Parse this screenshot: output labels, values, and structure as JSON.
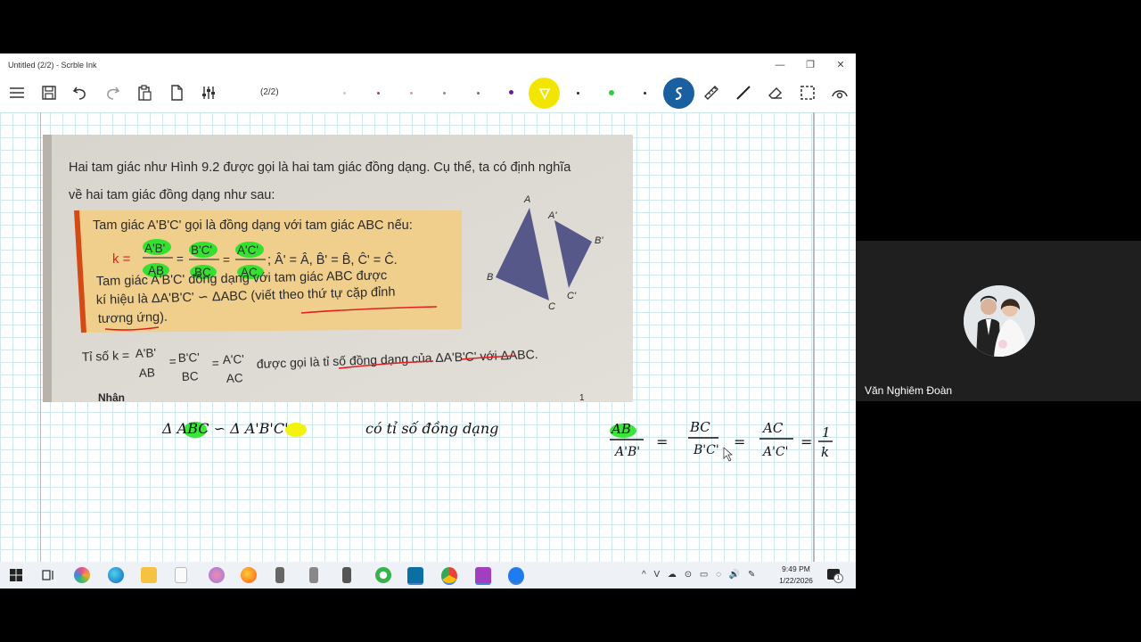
{
  "window": {
    "title": "Untitled (2/2) - Scrble Ink",
    "minimize": "—",
    "restore": "❐",
    "close": "✕"
  },
  "toolbar": {
    "page_indicator": "(2/2)",
    "pen_colors": [
      "#c8c8c8",
      "#d03030",
      "#c8a0b8",
      "#8a8a8a",
      "#707070",
      "#6a1f9a",
      "#f2e600",
      "#2a2a2a",
      "#2ecc40",
      "#2a2a2a"
    ],
    "active_tool_color": "#1a5fa0"
  },
  "textbook": {
    "intro_line1": "Hai tam giác như Hình 9.2 được gọi là hai tam giác đồng dạng. Cụ thể, ta có định nghĩa",
    "intro_line2": "về hai tam giác đồng dạng như sau:",
    "def_line1": "Tam giác A'B'C' gọi là đồng dạng với tam giác ABC nếu:",
    "def_k": "k =",
    "f1_num": "A'B'",
    "f1_den": "AB",
    "f2_num": "B'C'",
    "f2_den": "BC",
    "f3_num": "A'C'",
    "f3_den": "AC",
    "angles": "; Â' = Â, B̂' = B̂, Ĉ' = Ĉ.",
    "def_line3": "Tam giác A'B'C' đồng dạng với tam giác ABC được",
    "def_line4": "kí hiệu là ΔA'B'C' ∽ ΔABC (viết theo thứ tự cặp đỉnh",
    "def_line5": "tương ứng).",
    "ratio_label": "Tỉ số k =",
    "ratio_suffix": "được gọi là tỉ số đồng dạng của ΔA'B'C' với ΔABC.",
    "page_no": "1",
    "cut_text": "Nhận",
    "fig_labels": [
      "A",
      "A'",
      "B'",
      "B",
      "C'",
      "C"
    ]
  },
  "handwriting": {
    "similar_statement": "Δ ABC ∽ Δ A'B'C'",
    "ratio_text": "có tỉ số đồng dạng",
    "ratio_equation": {
      "fractions": [
        {
          "num": "AB",
          "den": "A'B'"
        },
        {
          "num": "BC",
          "den": "B'C'"
        },
        {
          "num": "AC",
          "den": "A'C'"
        },
        {
          "num": "1",
          "den": "k"
        }
      ],
      "equals": "="
    }
  },
  "taskbar": {
    "time": "9:49 PM",
    "date": "1/22/2026",
    "tray": "^ V ☁ ⊙ ▭ ◌ 🔊 ✎",
    "notification_count": "1"
  },
  "video": {
    "participant_name": "Văn Nghiêm Đoàn"
  }
}
